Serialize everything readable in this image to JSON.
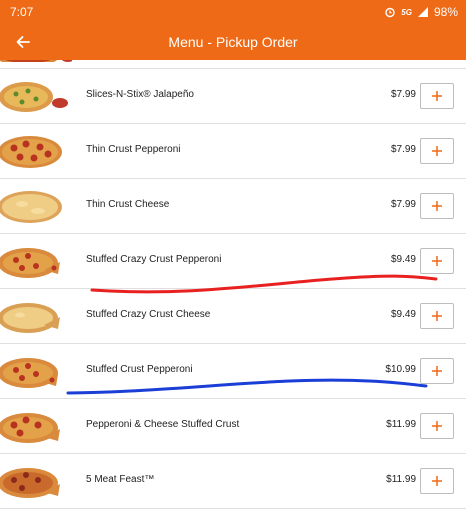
{
  "status_bar": {
    "time": "7:07",
    "network": "5G",
    "battery": "98%"
  },
  "app_bar": {
    "title": "Menu - Pickup Order"
  },
  "colors": {
    "brand_orange": "#ee6a16",
    "annotation_red": "#e8201f",
    "annotation_blue": "#1b3fd6"
  },
  "menu_items": [
    {
      "name": "",
      "price": ""
    },
    {
      "name": "Slices-N-Stix® Jalapeño",
      "price": "$7.99"
    },
    {
      "name": "Thin Crust Pepperoni",
      "price": "$7.99"
    },
    {
      "name": "Thin Crust Cheese",
      "price": "$7.99"
    },
    {
      "name": "Stuffed Crazy Crust Pepperoni",
      "price": "$9.49"
    },
    {
      "name": "Stuffed Crazy Crust Cheese",
      "price": "$9.49"
    },
    {
      "name": "Stuffed Crust Pepperoni",
      "price": "$10.99"
    },
    {
      "name": "Pepperoni & Cheese Stuffed Crust",
      "price": "$11.99"
    },
    {
      "name": "5 Meat Feast™",
      "price": "$11.99"
    }
  ]
}
